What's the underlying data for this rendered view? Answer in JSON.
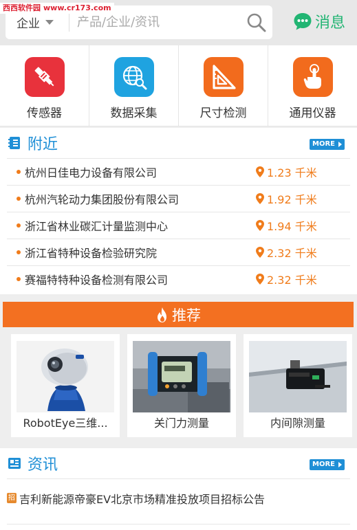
{
  "watermark": {
    "site_cn": "西西软件园",
    "url": "www.cr173.com"
  },
  "header": {
    "category": "企业",
    "search_placeholder": "产品/企业/资讯",
    "message_label": "消息"
  },
  "categories": [
    {
      "label": "传感器",
      "icon": "sensor-icon",
      "color": "#e8323c"
    },
    {
      "label": "数据采集",
      "icon": "globe-search-icon",
      "color": "#1fa3e0"
    },
    {
      "label": "尺寸检测",
      "icon": "set-square-icon",
      "color": "#f26b1d"
    },
    {
      "label": "通用仪器",
      "icon": "hand-tap-icon",
      "color": "#f26b1d"
    }
  ],
  "nearby": {
    "title": "附近",
    "more": "MORE",
    "items": [
      {
        "name": "杭州日佳电力设备有限公司",
        "distance": "1.23 千米"
      },
      {
        "name": "杭州汽轮动力集团股份有限公司",
        "distance": "1.92 千米"
      },
      {
        "name": "浙江省林业碳汇计量监测中心",
        "distance": "1.94 千米"
      },
      {
        "name": "浙江省特种设备检验研究院",
        "distance": "2.32 千米"
      },
      {
        "name": "赛福特特种设备检测有限公司",
        "distance": "2.32 千米"
      }
    ]
  },
  "recommend": {
    "title": "推荐",
    "products": [
      {
        "name": "RobotEye三维..."
      },
      {
        "name": "关门力测量"
      },
      {
        "name": "内间隙测量"
      }
    ]
  },
  "news": {
    "title": "资讯",
    "more": "MORE",
    "items": [
      {
        "tag": "招",
        "text": "吉利新能源帝豪EV北京市场精准投放项目招标公告"
      }
    ]
  },
  "colors": {
    "accent_blue": "#1f8fd6",
    "accent_orange": "#f37021",
    "message_green": "#22b573"
  }
}
